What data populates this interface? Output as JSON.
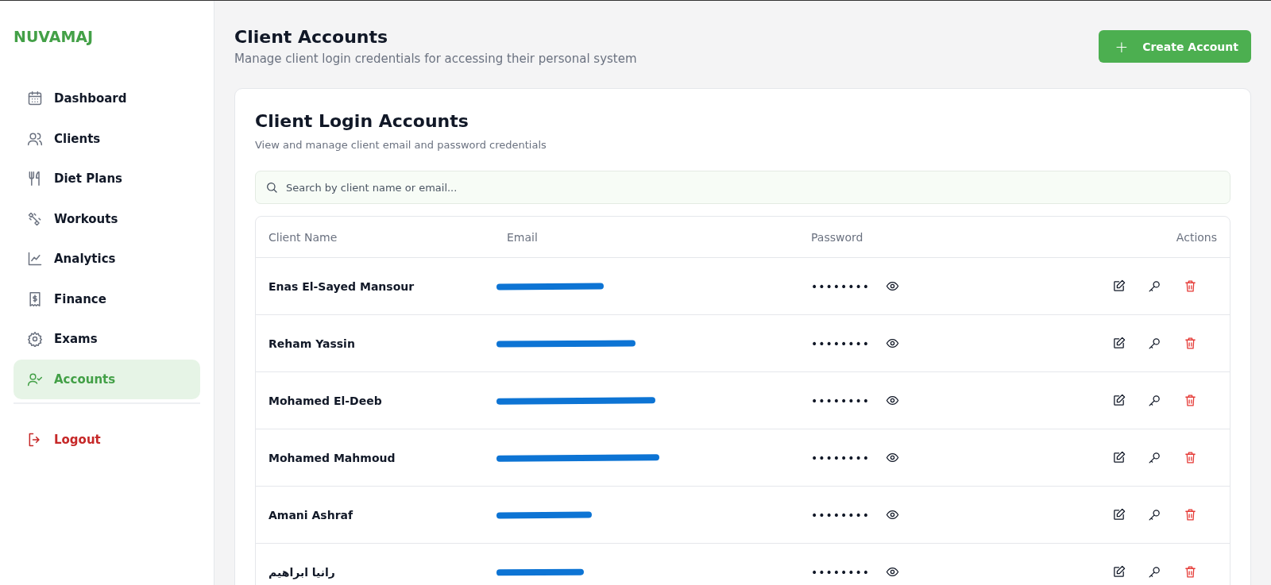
{
  "sidebar": {
    "logo": "NUVAMAJ",
    "items": [
      {
        "label": "Dashboard",
        "selected": false
      },
      {
        "label": "Clients",
        "selected": false
      },
      {
        "label": "Diet Plans",
        "selected": false
      },
      {
        "label": "Workouts",
        "selected": false
      },
      {
        "label": "Analytics",
        "selected": false
      },
      {
        "label": "Finance",
        "selected": false
      },
      {
        "label": "Exams",
        "selected": false
      },
      {
        "label": "Accounts",
        "selected": true
      }
    ],
    "logout": "Logout"
  },
  "header": {
    "title": "Client Accounts",
    "subtitle": "Manage client login credentials for accessing their personal system",
    "button": "Create Account",
    "button_icon": "+"
  },
  "card": {
    "title": "Client Login Accounts",
    "subtitle": "View and manage client email and password credentials",
    "search": {
      "placeholder": "Search by client name or email..."
    },
    "table": {
      "columns": [
        "Client Name",
        "Email",
        "Password",
        "Actions"
      ],
      "rows": [
        {
          "name": "Enas El-Sayed Mansour",
          "email_redacted": true,
          "password": "••••••••"
        },
        {
          "name": "Reham Yassin",
          "email_redacted": true,
          "password": "••••••••"
        },
        {
          "name": "Mohamed El-Deeb",
          "email_redacted": true,
          "password": "••••••••"
        },
        {
          "name": "Mohamed Mahmoud",
          "email_redacted": true,
          "password": "••••••••"
        },
        {
          "name": "Amani Ashraf",
          "email_redacted": true,
          "password": "••••••••"
        },
        {
          "name": "رانيا ابراهيم",
          "email_redacted": true,
          "password": "••••••••"
        }
      ]
    }
  }
}
